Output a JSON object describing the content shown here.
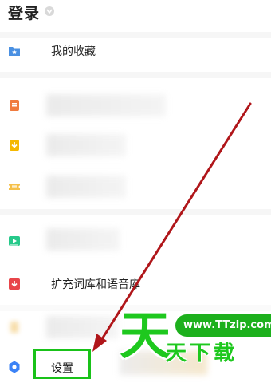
{
  "header": {
    "title": "登录"
  },
  "menu": {
    "favorites": "我的收藏",
    "expand_dictionary": "扩充词库和语音库",
    "settings": "设置"
  },
  "watermark": {
    "big_char": "天",
    "url": "www.TTzip.com",
    "subtitle": "天下载"
  },
  "colors": {
    "favorites_icon": "#4a90e2",
    "orange_icon": "#f07b3f",
    "yellow_icon": "#f5b800",
    "ticket_icon": "#f5c04a",
    "green_icon": "#26c98a",
    "red_icon": "#e8454a",
    "settings_icon": "#3b82f6",
    "highlight_border": "#19c219",
    "arrow": "#b0161a",
    "watermark_green": "#1ec81e"
  }
}
